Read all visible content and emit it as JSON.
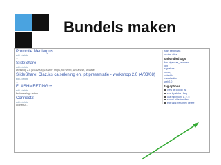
{
  "header": {
    "title": "Bundels maken"
  },
  "colors": {
    "accent": "#3355aa",
    "arrow": "#33aa33"
  },
  "main": {
    "items": [
      {
        "title": "Promotie Mediargus",
        "meta": "edit / delete",
        "desc": "..."
      },
      {
        "title": "SlideShare",
        "meta": "edit / delete",
        "desc": "workshop 2.0 (4/03/2008) Leuven · tirups, hoi Webb, Wri.001.ss, SrShare"
      },
      {
        "title": "SlideShare: Claz.ics ca selening en. plt presentatie - workshop 2.0 (4/03/08)",
        "meta": "edit / delete",
        "desc": "..."
      },
      {
        "title": "FLASHMEETING™",
        "meta": "edit / delete",
        "desc": "flashmeetings online"
      },
      {
        "title": "Connect2",
        "meta": "edit / delete",
        "desc": "connect2 ..."
      }
    ]
  },
  "sidebar": {
    "top_links": [
      "start bergmaas",
      "similar sites"
    ],
    "unbundled_heading": "unbundled tags",
    "unbundled_tags": [
      "fan.uiganaaa_taumnen",
      "dbt",
      "signature",
      "survey",
      "videol.k",
      "visualization",
      "web2.0"
    ],
    "options_heading": "tag options",
    "options": [
      "view as cloud | list",
      "sort by alpha | freq",
      "use minimum: 1, 2, 5",
      "show / hide bundles",
      "edit tags: rename | delete"
    ]
  }
}
